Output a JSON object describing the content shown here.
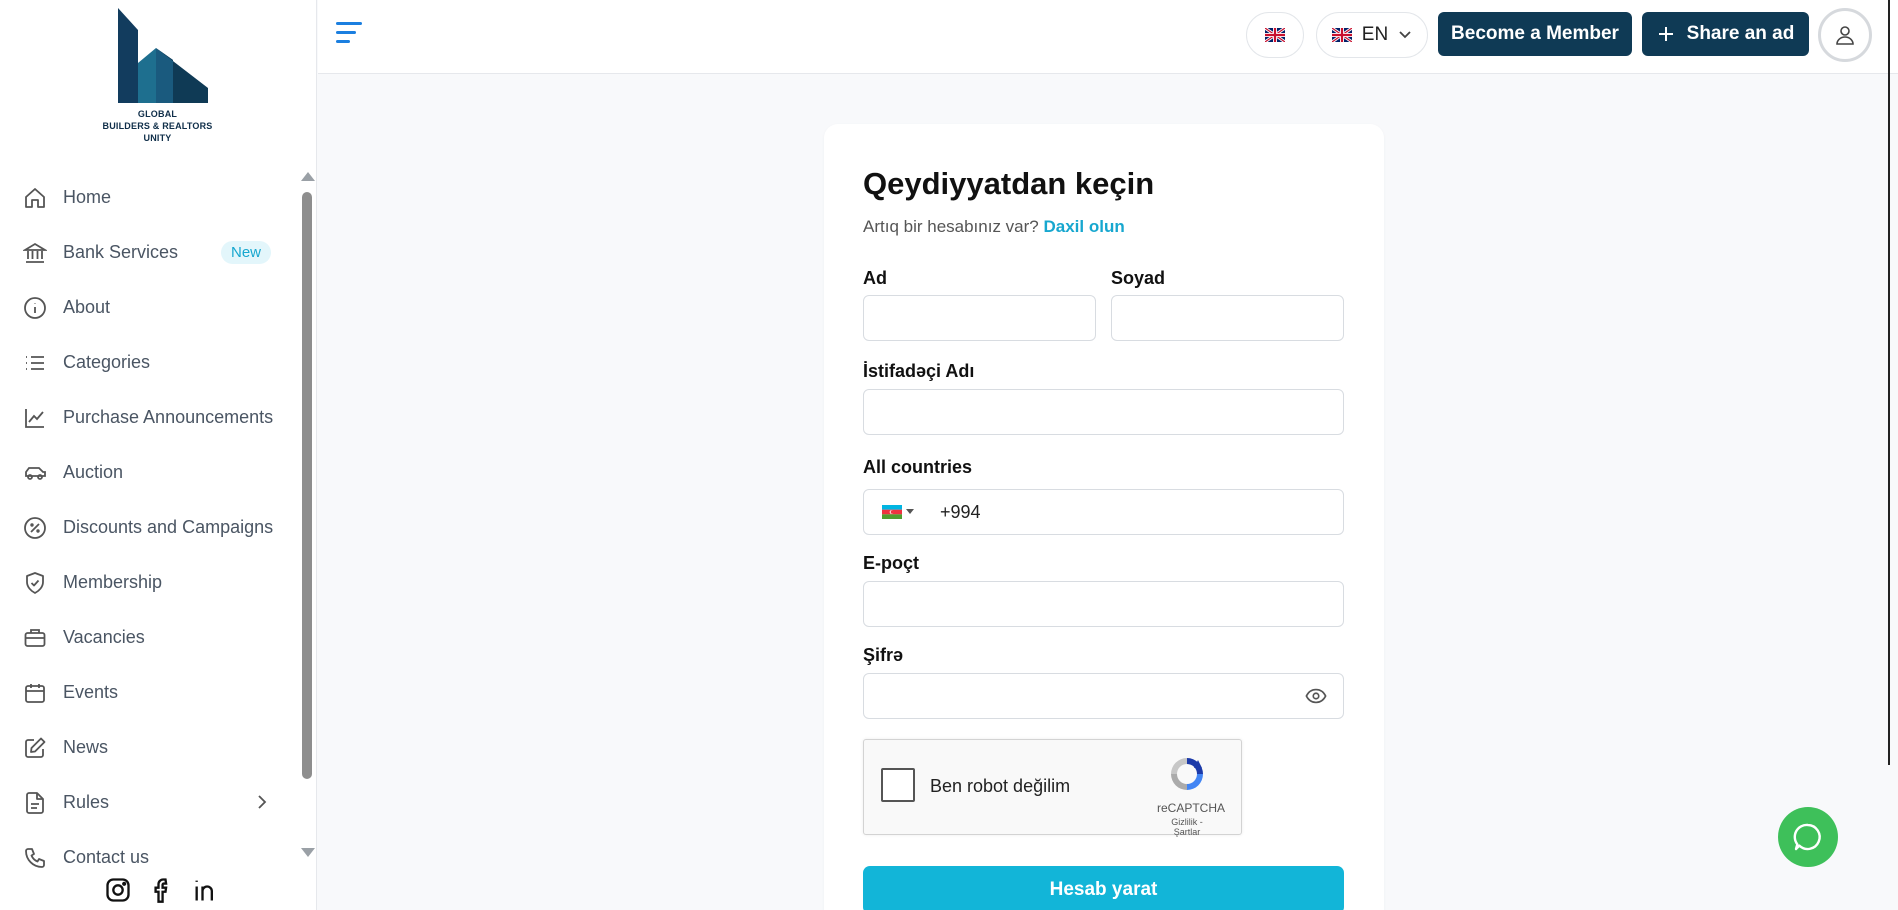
{
  "logo": {
    "line1": "GLOBAL",
    "line2": "BUILDERS & REALTORS",
    "line3": "UNITY"
  },
  "sidebar": {
    "items": [
      {
        "label": "Home",
        "icon": "home-icon"
      },
      {
        "label": "Bank Services",
        "icon": "bank-icon",
        "badge": "New"
      },
      {
        "label": "About",
        "icon": "info-icon"
      },
      {
        "label": "Categories",
        "icon": "list-icon"
      },
      {
        "label": "Purchase Announcements",
        "icon": "chart-line-icon"
      },
      {
        "label": "Auction",
        "icon": "car-icon"
      },
      {
        "label": "Discounts and Campaigns",
        "icon": "percent-badge-icon"
      },
      {
        "label": "Membership",
        "icon": "shield-check-icon"
      },
      {
        "label": "Vacancies",
        "icon": "briefcase-icon"
      },
      {
        "label": "Events",
        "icon": "calendar-icon"
      },
      {
        "label": "News",
        "icon": "edit-icon"
      },
      {
        "label": "Rules",
        "icon": "document-icon"
      },
      {
        "label": "Contact us",
        "icon": "phone-icon"
      }
    ]
  },
  "header": {
    "language": "EN",
    "become_member": "Become a Member",
    "share_ad": "Share an ad"
  },
  "form": {
    "title": "Qeydiyyatdan keçin",
    "subtitle": "Artıq bir hesabınız var?",
    "login_link": "Daxil olun",
    "first_name_label": "Ad",
    "last_name_label": "Soyad",
    "username_label": "İstifadəçi Adı",
    "country_label": "All countries",
    "phone_code": "+994",
    "email_label": "E-poçt",
    "password_label": "Şifrə",
    "submit": "Hesab yarat"
  },
  "captcha": {
    "label": "Ben robot değilim",
    "brand": "reCAPTCHA",
    "terms": "Gizlilik - Şartlar"
  },
  "colors": {
    "brand_dark": "#0f3a55",
    "accent": "#12b5d8",
    "whatsapp": "#3ec05a"
  }
}
